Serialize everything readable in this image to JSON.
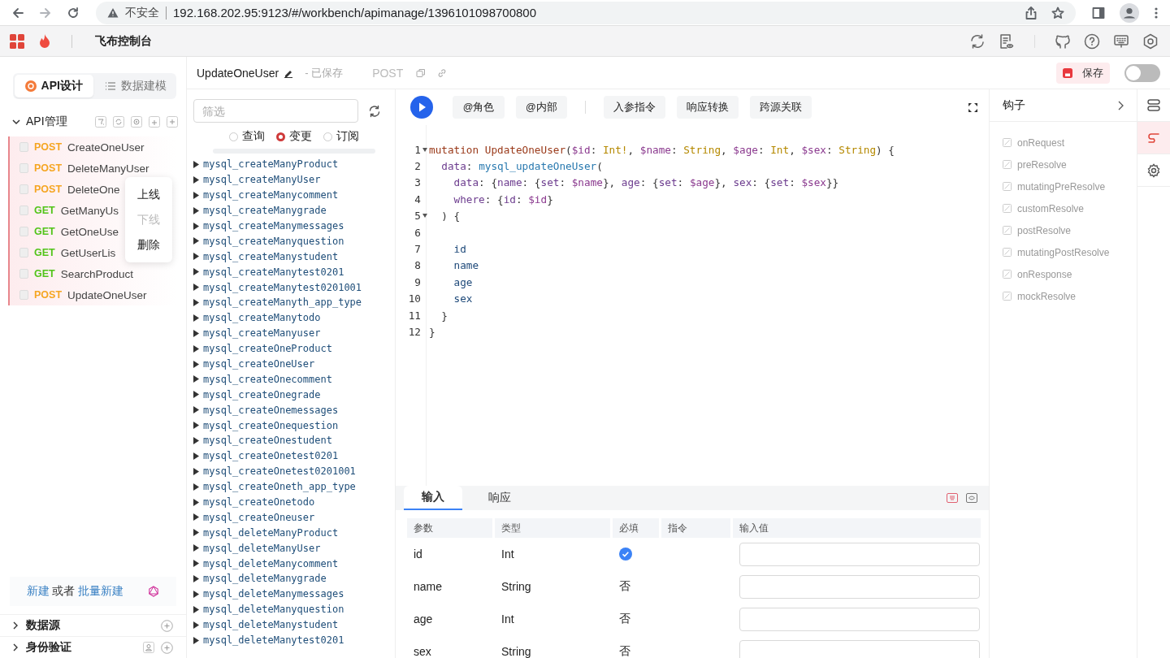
{
  "browser": {
    "security": "不安全",
    "url": "192.168.202.95:9123/#/workbench/apimanage/1396101098700800"
  },
  "app": {
    "title": "飞布控制台"
  },
  "sidebar": {
    "tabs": [
      {
        "label": "API设计",
        "selected": true
      },
      {
        "label": "数据建模",
        "selected": false
      }
    ],
    "section": {
      "title": "API管理",
      "expanded": true
    },
    "apis": [
      {
        "method": "POST",
        "color": "#f5a623",
        "name": "CreateOneUser"
      },
      {
        "method": "POST",
        "color": "#f5a623",
        "name": "DeleteManyUser"
      },
      {
        "method": "POST",
        "color": "#f5a623",
        "name": "DeleteOne"
      },
      {
        "method": "GET",
        "color": "#52c41a",
        "name": "GetManyUs"
      },
      {
        "method": "GET",
        "color": "#52c41a",
        "name": "GetOneUse"
      },
      {
        "method": "GET",
        "color": "#52c41a",
        "name": "GetUserLis"
      },
      {
        "method": "GET",
        "color": "#52c41a",
        "name": "SearchProduct"
      },
      {
        "method": "POST",
        "color": "#f5a623",
        "name": "UpdateOneUser"
      }
    ],
    "context_menu": [
      {
        "label": "上线",
        "disabled": false
      },
      {
        "label": "下线",
        "disabled": true
      },
      {
        "label": "删除",
        "disabled": false
      }
    ],
    "create_hint": {
      "link": "新建",
      "text": "或者",
      "link2": "批量新建"
    },
    "groups": [
      {
        "title": "数据源",
        "kind": "plain"
      },
      {
        "title": "身份验证",
        "kind": "user"
      }
    ]
  },
  "api_header": {
    "name": "UpdateOneUser",
    "status": "- 已保存",
    "method": "POST",
    "save": "保存",
    "toggle_on": false
  },
  "operations": {
    "filter_placeholder": "筛选",
    "types": [
      {
        "label": "查询",
        "selected": false
      },
      {
        "label": "变更",
        "selected": true
      },
      {
        "label": "订阅",
        "selected": false
      }
    ],
    "items": [
      "mysql_createManyProduct",
      "mysql_createManyUser",
      "mysql_createManycomment",
      "mysql_createManygrade",
      "mysql_createManymessages",
      "mysql_createManyquestion",
      "mysql_createManystudent",
      "mysql_createManytest0201",
      "mysql_createManytest0201001",
      "mysql_createManyth_app_type",
      "mysql_createManytodo",
      "mysql_createManyuser",
      "mysql_createOneProduct",
      "mysql_createOneUser",
      "mysql_createOnecomment",
      "mysql_createOnegrade",
      "mysql_createOnemessages",
      "mysql_createOnequestion",
      "mysql_createOnestudent",
      "mysql_createOnetest0201",
      "mysql_createOnetest0201001",
      "mysql_createOneth_app_type",
      "mysql_createOnetodo",
      "mysql_createOneuser",
      "mysql_deleteManyProduct",
      "mysql_deleteManyUser",
      "mysql_deleteManycomment",
      "mysql_deleteManygrade",
      "mysql_deleteManymessages",
      "mysql_deleteManyquestion",
      "mysql_deleteManystudent",
      "mysql_deleteManytest0201"
    ]
  },
  "toolbar": {
    "buttons": [
      "@角色",
      "@内部"
    ],
    "buttons2": [
      "入参指令",
      "响应转换",
      "跨源关联"
    ]
  },
  "code": [
    {
      "number": "1",
      "fold": true,
      "tokens": [
        {
          "t": "mutation ",
          "kind": "kw"
        },
        {
          "t": "UpdateOneUser",
          "kind": "kw"
        },
        {
          "t": "(",
          "kind": "p"
        },
        {
          "t": "$id",
          "kind": "var"
        },
        {
          "t": ": ",
          "kind": "p"
        },
        {
          "t": "Int!",
          "kind": "type"
        },
        {
          "t": ", ",
          "kind": "p"
        },
        {
          "t": "$name",
          "kind": "var"
        },
        {
          "t": ": ",
          "kind": "p"
        },
        {
          "t": "String",
          "kind": "type"
        },
        {
          "t": ", ",
          "kind": "p"
        },
        {
          "t": "$age",
          "kind": "var"
        },
        {
          "t": ": ",
          "kind": "p"
        },
        {
          "t": "Int",
          "kind": "type"
        },
        {
          "t": ", ",
          "kind": "p"
        },
        {
          "t": "$sex",
          "kind": "var"
        },
        {
          "t": ": ",
          "kind": "p"
        },
        {
          "t": "String",
          "kind": "type"
        },
        {
          "t": ") {",
          "kind": "p"
        }
      ]
    },
    {
      "number": "2",
      "fold": false,
      "tokens": [
        {
          "t": "  data",
          "kind": "arg"
        },
        {
          "t": ": ",
          "kind": "p"
        },
        {
          "t": "mysql_updateOneUser",
          "kind": "call"
        },
        {
          "t": "(",
          "kind": "p"
        }
      ]
    },
    {
      "number": "3",
      "fold": false,
      "tokens": [
        {
          "t": "    data",
          "kind": "arg"
        },
        {
          "t": ": {",
          "kind": "p"
        },
        {
          "t": "name",
          "kind": "arg"
        },
        {
          "t": ": {",
          "kind": "p"
        },
        {
          "t": "set",
          "kind": "arg"
        },
        {
          "t": ": ",
          "kind": "p"
        },
        {
          "t": "$name",
          "kind": "var"
        },
        {
          "t": "}, ",
          "kind": "p"
        },
        {
          "t": "age",
          "kind": "arg"
        },
        {
          "t": ": {",
          "kind": "p"
        },
        {
          "t": "set",
          "kind": "arg"
        },
        {
          "t": ": ",
          "kind": "p"
        },
        {
          "t": "$age",
          "kind": "var"
        },
        {
          "t": "}, ",
          "kind": "p"
        },
        {
          "t": "sex",
          "kind": "arg"
        },
        {
          "t": ": {",
          "kind": "p"
        },
        {
          "t": "set",
          "kind": "arg"
        },
        {
          "t": ": ",
          "kind": "p"
        },
        {
          "t": "$sex",
          "kind": "var"
        },
        {
          "t": "}}",
          "kind": "p"
        }
      ]
    },
    {
      "number": "4",
      "fold": false,
      "tokens": [
        {
          "t": "    where",
          "kind": "arg"
        },
        {
          "t": ": {",
          "kind": "p"
        },
        {
          "t": "id",
          "kind": "arg"
        },
        {
          "t": ": ",
          "kind": "p"
        },
        {
          "t": "$id",
          "kind": "var"
        },
        {
          "t": "}",
          "kind": "p"
        }
      ]
    },
    {
      "number": "5",
      "fold": true,
      "tokens": [
        {
          "t": "  ) {",
          "kind": "p"
        }
      ]
    },
    {
      "number": "6",
      "fold": false
    },
    {
      "number": "7",
      "fold": false,
      "tokens": [
        {
          "t": "    id",
          "kind": "field"
        }
      ]
    },
    {
      "number": "8",
      "fold": false,
      "tokens": [
        {
          "t": "    name",
          "kind": "field"
        }
      ]
    },
    {
      "number": "9",
      "fold": false,
      "tokens": [
        {
          "t": "    age",
          "kind": "field"
        }
      ]
    },
    {
      "number": "10",
      "fold": false,
      "tokens": [
        {
          "t": "    sex",
          "kind": "field"
        }
      ]
    },
    {
      "number": "11",
      "fold": false,
      "tokens": [
        {
          "t": "  }",
          "kind": "p"
        }
      ]
    },
    {
      "number": "12",
      "fold": false,
      "tokens": [
        {
          "t": "}",
          "kind": "p"
        }
      ]
    }
  ],
  "bottom": {
    "tabs": [
      {
        "label": "输入",
        "selected": true
      },
      {
        "label": "响应",
        "selected": false
      }
    ],
    "columns": [
      "参数",
      "类型",
      "必填",
      "指令",
      "输入值"
    ],
    "rows": [
      {
        "param": "id",
        "type": "Int",
        "required": true
      },
      {
        "param": "name",
        "type": "String",
        "required": false,
        "required_label": "否"
      },
      {
        "param": "age",
        "type": "Int",
        "required": false,
        "required_label": "否"
      },
      {
        "param": "sex",
        "type": "String",
        "required": false,
        "required_label": "否"
      }
    ]
  },
  "hooks": {
    "title": "钩子",
    "items": [
      "onRequest",
      "preResolve",
      "mutatingPreResolve",
      "customResolve",
      "postResolve",
      "mutatingPostResolve",
      "onResponse",
      "mockResolve"
    ]
  },
  "rail": [
    {
      "kind": "settings-list",
      "selected": false
    },
    {
      "kind": "hook",
      "selected": true
    },
    {
      "kind": "gear",
      "selected": false
    }
  ]
}
